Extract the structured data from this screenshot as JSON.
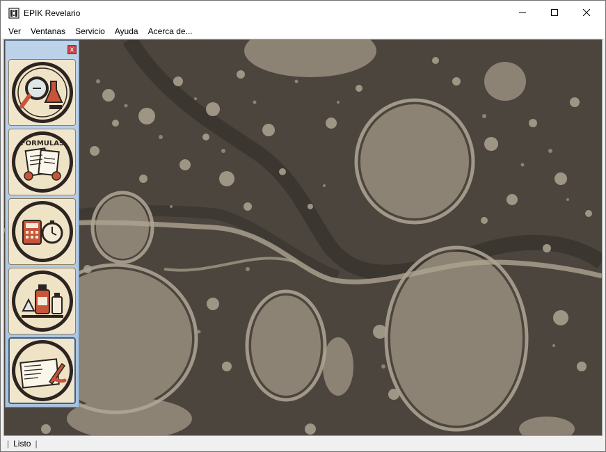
{
  "window": {
    "title": "EPIK Revelario",
    "app_icon": "film-reel-icon"
  },
  "menu": {
    "items": [
      "Ver",
      "Ventanas",
      "Servicio",
      "Ayuda",
      "Acerca de..."
    ]
  },
  "tool_panel": {
    "close_label": "x",
    "tools": [
      {
        "name": "tool-analysis",
        "icon": "magnifier-flask-icon",
        "label": ""
      },
      {
        "name": "tool-formulas",
        "icon": "formulas-book-icon",
        "label": "FORMULAS"
      },
      {
        "name": "tool-calculator",
        "icon": "calculator-timer-icon",
        "label": ""
      },
      {
        "name": "tool-chemicals",
        "icon": "chemicals-bottles-icon",
        "label": ""
      },
      {
        "name": "tool-notes",
        "icon": "notebook-pen-icon",
        "label": ""
      }
    ],
    "selected_tool": "tool-notes"
  },
  "statusbar": {
    "text": "Listo",
    "separator": "|"
  },
  "colors": {
    "marble_dark": "#4a433d",
    "marble_light": "#b4a896",
    "panel_bg": "#b9d0e8",
    "button_bg": "#f1e6cc",
    "emblem_dark": "#2b2420",
    "accent_red": "#c8553a"
  }
}
